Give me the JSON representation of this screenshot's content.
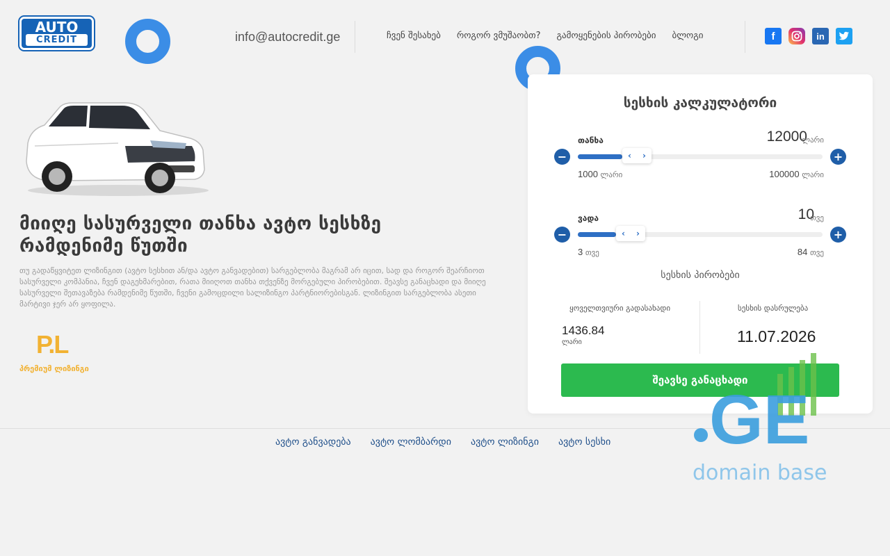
{
  "header": {
    "logo": {
      "line1": "AUTO",
      "line2": "CREDIT"
    },
    "email": "info@autocredit.ge",
    "nav": [
      "ჩვენ შესახებ",
      "როგორ ვმუშაობთ?",
      "გამოყენების პირობები",
      "ბლოგი"
    ],
    "social": [
      {
        "icon": "facebook-icon",
        "glyph": "f",
        "color": "#1877f2"
      },
      {
        "icon": "instagram-icon",
        "glyph": "◎",
        "color": "#e1306c"
      },
      {
        "icon": "linkedin-icon",
        "glyph": "in",
        "color": "#2a67b3"
      },
      {
        "icon": "twitter-icon",
        "glyph": "🐦",
        "color": "#1da1f2"
      }
    ]
  },
  "hero": {
    "headline": "მიიღე სასურველი თანხა ავტო სესხზე რამდენიმე წუთში",
    "description": "თუ გადაწყვიტეთ ლიზინგით (ავტო სესხით ან/და ავტო განვადებით) სარგებლობა მაგრამ არ იცით, სად და როგორ შეარჩიოთ სასურველი კომპანია, ჩვენ დაგეხმარებით, რათა მიიღოთ თანხა თქვენზე მორგებული პირობებით. შეავსე განაცხადი და მიიღე სასურველი შეთავაზება რამდენიმე წუთში, ჩვენი გამოცდილი სალიზინგო პარტნიორებისგან. ლიზინგით სარგებლობა ასეთი მარტივი ჯერ არ ყოფილა.",
    "partner": {
      "mark": "P.L",
      "text": "პრემიუმ ლიზინგი"
    }
  },
  "calculator": {
    "title": "სესხის კალკულატორი",
    "amount": {
      "label": "თანხა",
      "value": "12000",
      "unit": "ლარი",
      "min": "1000",
      "max": "100000",
      "fraction": 0.111
    },
    "term": {
      "label": "ვადა",
      "value": "10",
      "unit": "თვე",
      "min": "3",
      "max": "84",
      "fraction": 0.086
    },
    "terms_link": "სესხის პირობები",
    "monthly_label": "ყოველთვიური გადასახადი",
    "monthly_value": "1436.84",
    "monthly_unit": "ლარი",
    "end_label": "სესხის დასრულება",
    "end_value": "11.07.2026",
    "apply_label": "შეავსე განაცხადი"
  },
  "footer": {
    "links": [
      "ავტო განვადება",
      "ავტო ლომბარდი",
      "ავტო ლიზინგი",
      "ავტო სესხი"
    ]
  },
  "watermark": {
    "big": ".GE",
    "small": "domain base"
  },
  "colors": {
    "accent": "#2e6fc4",
    "button": "#2cba4f",
    "ring": "#3b8de6"
  }
}
